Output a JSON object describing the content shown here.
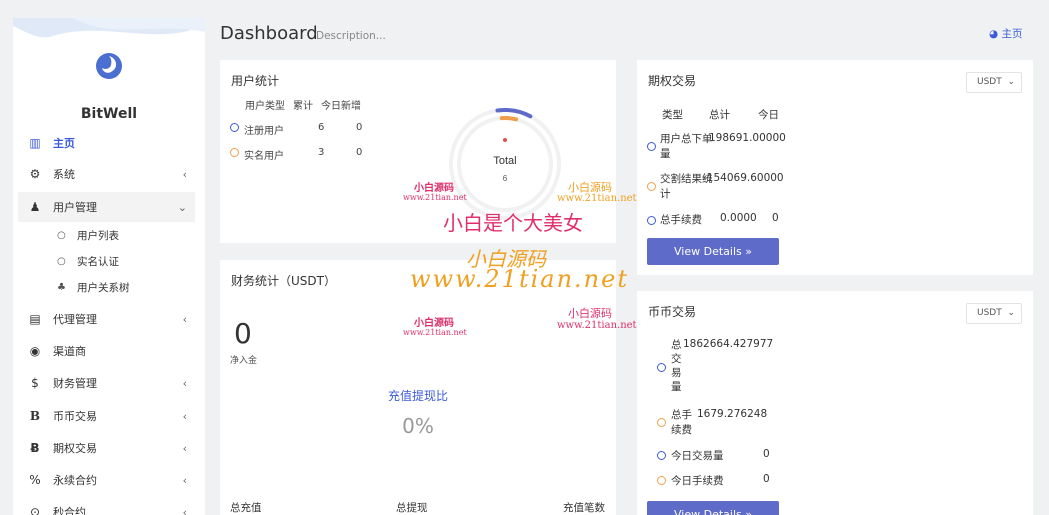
{
  "sidebar": {
    "brand": "BitWell",
    "items": [
      {
        "label": "主页",
        "icon": "bar-chart-icon",
        "glyph": "▥"
      },
      {
        "label": "系统",
        "icon": "gear-icon",
        "glyph": "⚙",
        "chev": "‹"
      },
      {
        "label": "用户管理",
        "icon": "user-icon",
        "glyph": "♟",
        "chev": "⌄"
      },
      {
        "label": "代理管理",
        "icon": "id-card-icon",
        "glyph": "▤",
        "chev": "‹"
      },
      {
        "label": "渠道商",
        "icon": "user-circle-icon",
        "glyph": "◉"
      },
      {
        "label": "财务管理",
        "icon": "dollar-icon",
        "glyph": "$",
        "chev": "‹"
      },
      {
        "label": "币币交易",
        "icon": "b-icon",
        "glyph": "B",
        "chev": "‹"
      },
      {
        "label": "期权交易",
        "icon": "bitcoin-icon",
        "glyph": "Ƀ",
        "chev": "‹"
      },
      {
        "label": "永续合约",
        "icon": "link-icon",
        "glyph": "%",
        "chev": "‹"
      },
      {
        "label": "秒合约",
        "icon": "target-icon",
        "glyph": "⊙",
        "chev": "‹"
      }
    ],
    "sub_items": [
      {
        "label": "用户列表",
        "icon": "circle-icon",
        "glyph": "○"
      },
      {
        "label": "实名认证",
        "icon": "circle-icon",
        "glyph": "○"
      },
      {
        "label": "用户关系树",
        "icon": "tree-icon",
        "glyph": "♣"
      }
    ]
  },
  "header": {
    "title": "Dashboard",
    "description": "Description...",
    "home": "主页"
  },
  "user_stats": {
    "title": "用户统计",
    "columns": [
      "用户类型",
      "累计",
      "今日新增"
    ],
    "rows": [
      {
        "type": "注册用户",
        "total": "6",
        "today": "0"
      },
      {
        "type": "实名用户",
        "total": "3",
        "today": "0"
      }
    ],
    "donut_label": "Total",
    "donut_value": "6",
    "donut_parts": [
      6,
      3
    ],
    "colors": {
      "blue": "#5e6bc9",
      "orange": "#f0a04b",
      "red": "#e05252"
    }
  },
  "finance": {
    "title": "财务统计（USDT）",
    "net": "0",
    "net_label": "净入金",
    "ratio_label": "充值提现比",
    "ratio_value": "0%",
    "footer": [
      "总充值",
      "总提现",
      "充值笔数"
    ]
  },
  "options": {
    "title": "期权交易",
    "currency": "USDT",
    "columns": [
      "类型",
      "总计",
      "今日"
    ],
    "rows": [
      {
        "type": "用户总下单量",
        "total": "198691.00000",
        "today": ""
      },
      {
        "type": "交割结果统计",
        "total": "-154069.60000",
        "today": ""
      },
      {
        "type": "总手续费",
        "total": "0.0000",
        "today": "0"
      }
    ],
    "button": "View Details »"
  },
  "spot": {
    "title": "币币交易",
    "currency": "USDT",
    "rows": [
      {
        "type": "总交易量",
        "total": "1862664.427977"
      },
      {
        "type": "总手续费",
        "total": "1679.276248"
      },
      {
        "type": "今日交易量",
        "total": "0"
      },
      {
        "type": "今日手续费",
        "total": "0"
      }
    ],
    "button": "View Details »"
  },
  "watermarks": {
    "main": "小白是个大美女",
    "site_a": "小白源码",
    "site_url": "www.21tian.net",
    "big_title": "小白源码",
    "big_url": "www.21tian.net"
  }
}
